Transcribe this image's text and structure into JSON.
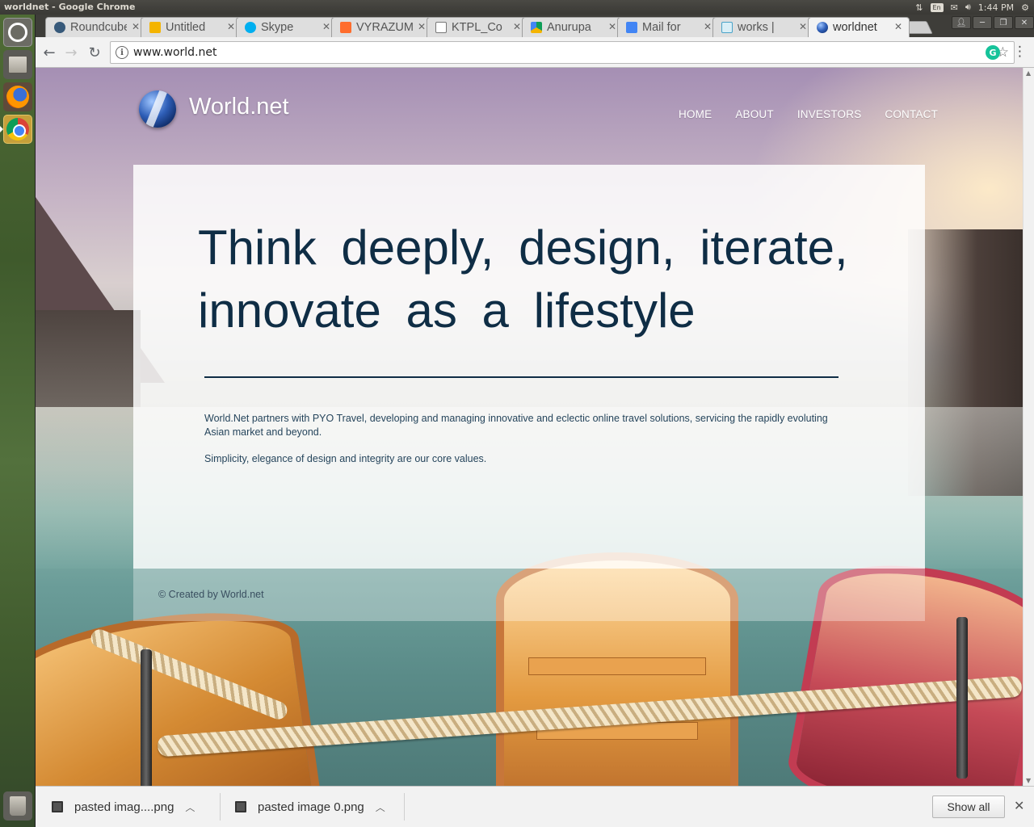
{
  "os": {
    "window_title": "worldnet - Google Chrome",
    "keyboard_layout": "En",
    "clock": "1:44 PM"
  },
  "tabs": [
    {
      "title": "Roundcube",
      "favicon": "roundcube-icon",
      "color": "#37597a"
    },
    {
      "title": "Untitled",
      "favicon": "slides-icon",
      "color": "#f4b400"
    },
    {
      "title": "Skype",
      "favicon": "skype-icon",
      "color": "#00aff0"
    },
    {
      "title": "VYRAZUM",
      "favicon": "p-logo-icon",
      "color": "#ff6d2d"
    },
    {
      "title": "KTPL_Co",
      "favicon": "document-icon",
      "color": "#777777"
    },
    {
      "title": "Anurupa",
      "favicon": "drive-icon",
      "color": "#0f9d58"
    },
    {
      "title": "Mail for",
      "favicon": "docs-icon",
      "color": "#4285f4"
    },
    {
      "title": "works |",
      "favicon": "heart-icon",
      "color": "#4aa3c8"
    },
    {
      "title": "worldnet",
      "favicon": "worldnet-icon",
      "color": "#2f5fb8",
      "active": true
    }
  ],
  "toolbar": {
    "url": "www.world.net"
  },
  "site": {
    "name": "World.net",
    "nav": [
      "HOME",
      "ABOUT",
      "INVESTORS",
      "CONTACT"
    ],
    "headline": "Think  deeply,  design,  iterate, innovate as a lifestyle",
    "paragraph": "World.Net partners with PYO Travel, developing and managing innovative and eclectic online travel solutions, servicing the rapidly evoluting Asian market and beyond.",
    "values": "Simplicity, elegance of design and integrity are our core values.",
    "footer": "©  Created by  World.net"
  },
  "downloads": {
    "items": [
      "pasted imag....png",
      "pasted image 0.png"
    ],
    "show_all": "Show all"
  }
}
